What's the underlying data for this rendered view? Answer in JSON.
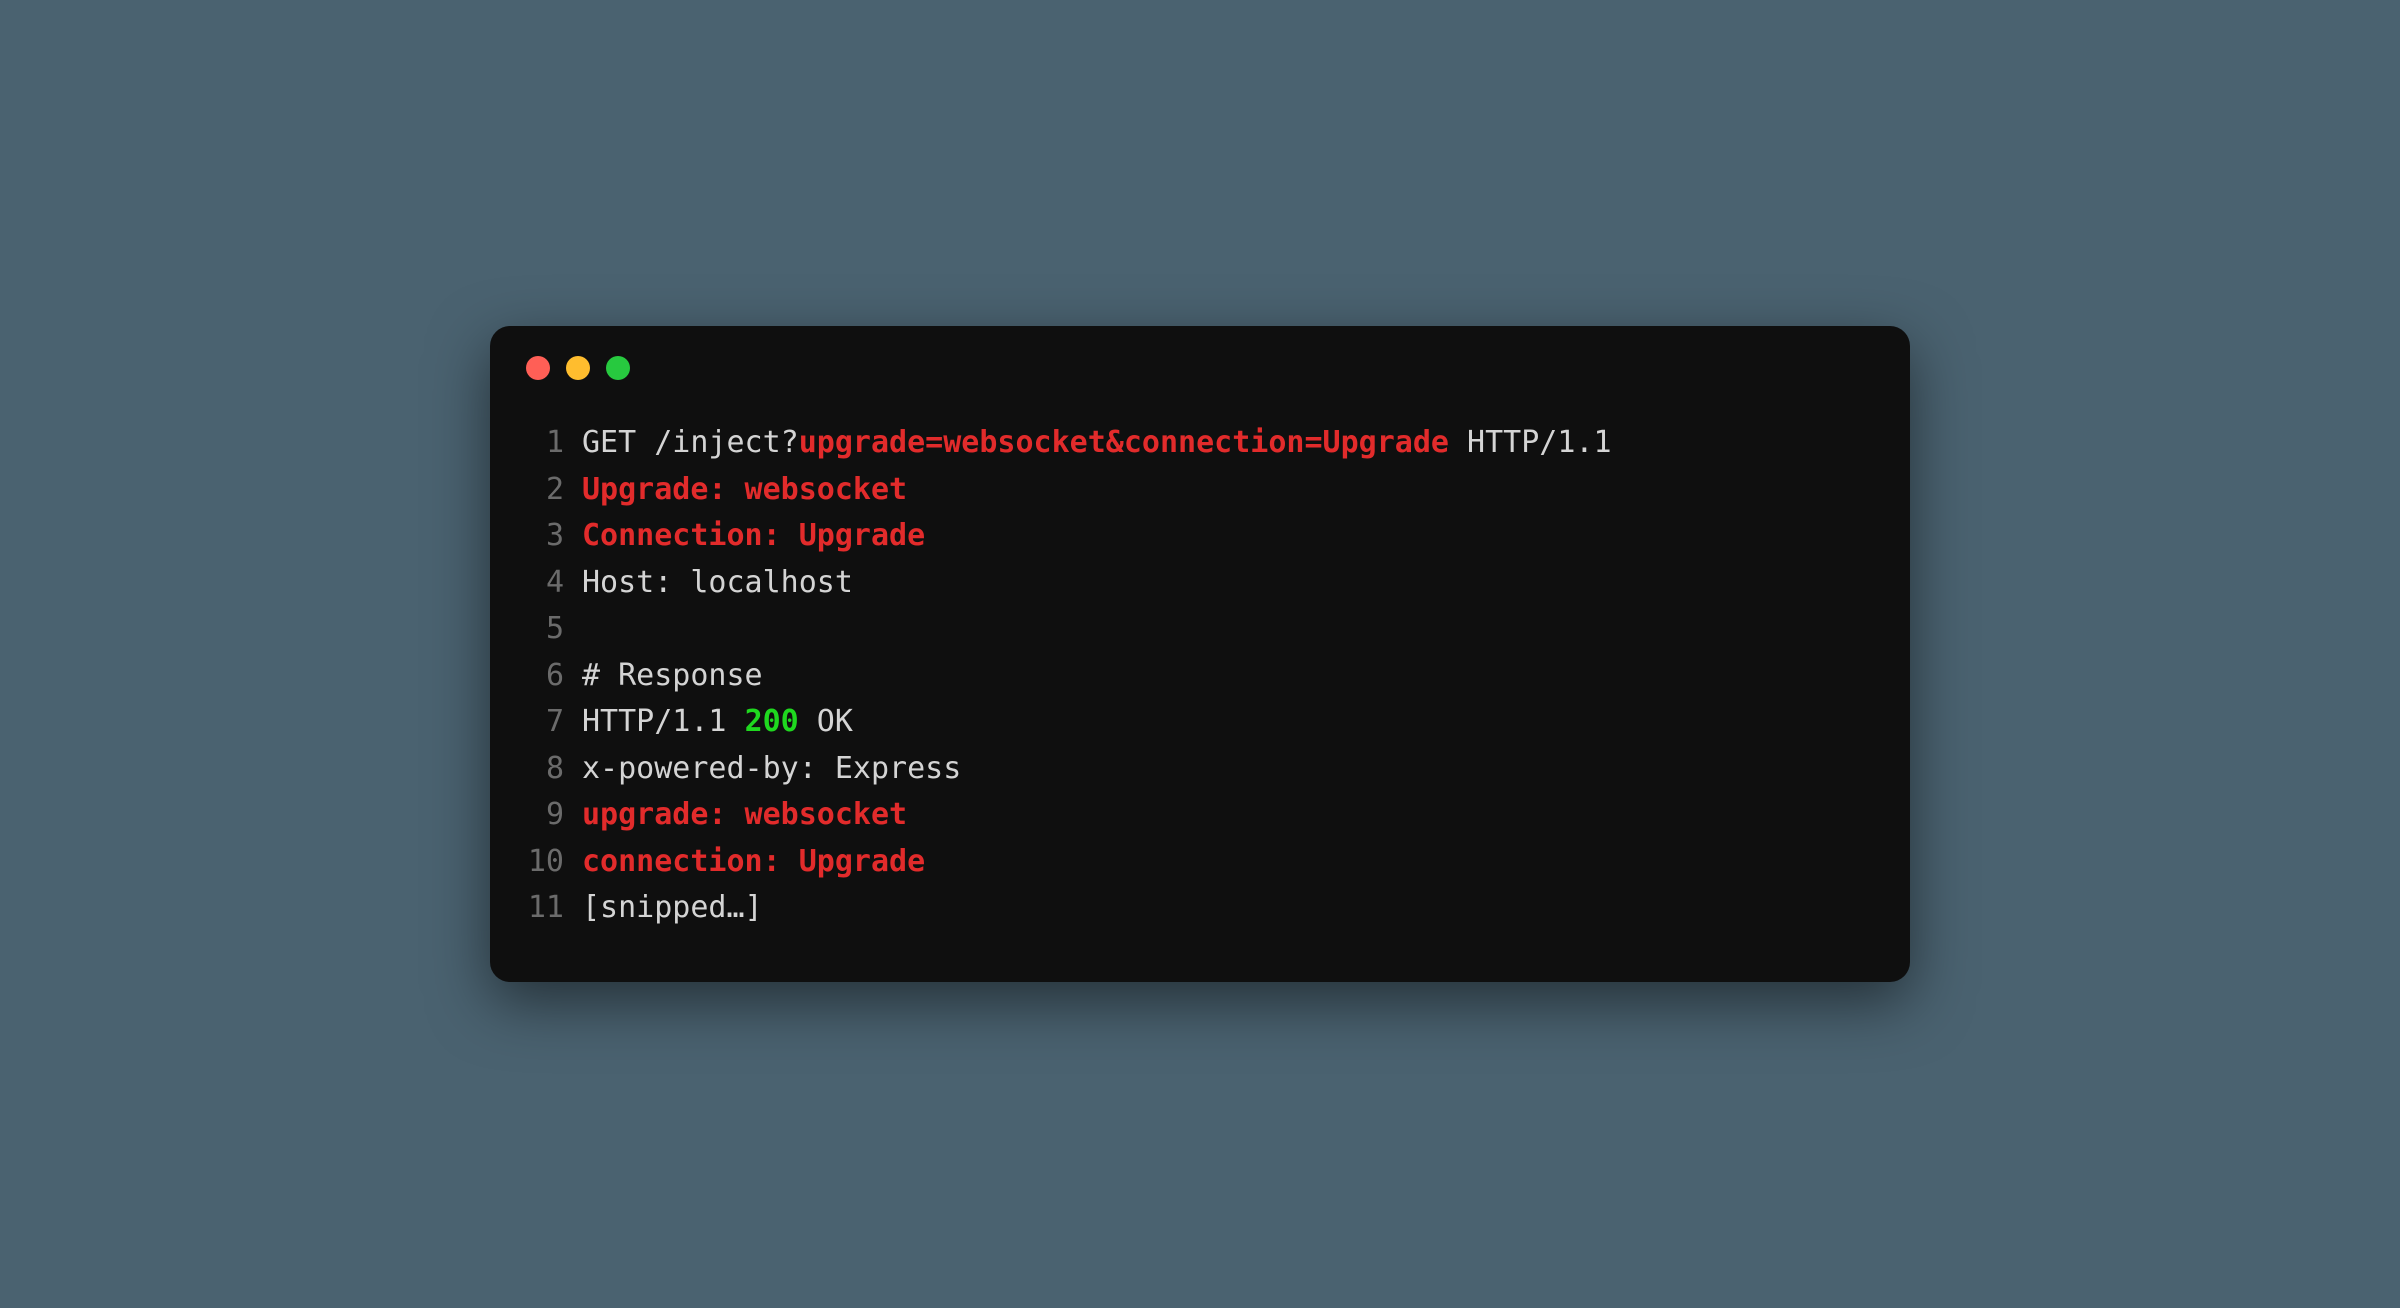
{
  "colors": {
    "red_dot": "#ff5f56",
    "yellow_dot": "#ffbd2e",
    "green_dot": "#27c93f",
    "highlight_red": "#e22b2b",
    "highlight_green": "#1fd81f"
  },
  "lines": [
    {
      "num": "1",
      "segments": [
        {
          "t": "GET /inject?",
          "c": ""
        },
        {
          "t": "upgrade=websocket&connection=Upgrade",
          "c": "red-text"
        },
        {
          "t": " HTTP/1.1",
          "c": ""
        }
      ]
    },
    {
      "num": "2",
      "segments": [
        {
          "t": "Upgrade: websocket",
          "c": "red-text"
        }
      ]
    },
    {
      "num": "3",
      "segments": [
        {
          "t": "Connection: Upgrade",
          "c": "red-text"
        }
      ]
    },
    {
      "num": "4",
      "segments": [
        {
          "t": "Host: localhost",
          "c": ""
        }
      ]
    },
    {
      "num": "5",
      "segments": [
        {
          "t": "",
          "c": ""
        }
      ]
    },
    {
      "num": "6",
      "segments": [
        {
          "t": "# Response",
          "c": ""
        }
      ]
    },
    {
      "num": "7",
      "segments": [
        {
          "t": "HTTP/1.1 ",
          "c": ""
        },
        {
          "t": "200",
          "c": "green-text"
        },
        {
          "t": " OK",
          "c": ""
        }
      ]
    },
    {
      "num": "8",
      "segments": [
        {
          "t": "x-powered-by: Express",
          "c": ""
        }
      ]
    },
    {
      "num": "9",
      "segments": [
        {
          "t": "upgrade: websocket",
          "c": "red-text"
        }
      ]
    },
    {
      "num": "10",
      "segments": [
        {
          "t": "connection: Upgrade",
          "c": "red-text"
        }
      ]
    },
    {
      "num": "11",
      "segments": [
        {
          "t": "[snipped…]",
          "c": ""
        }
      ]
    }
  ]
}
